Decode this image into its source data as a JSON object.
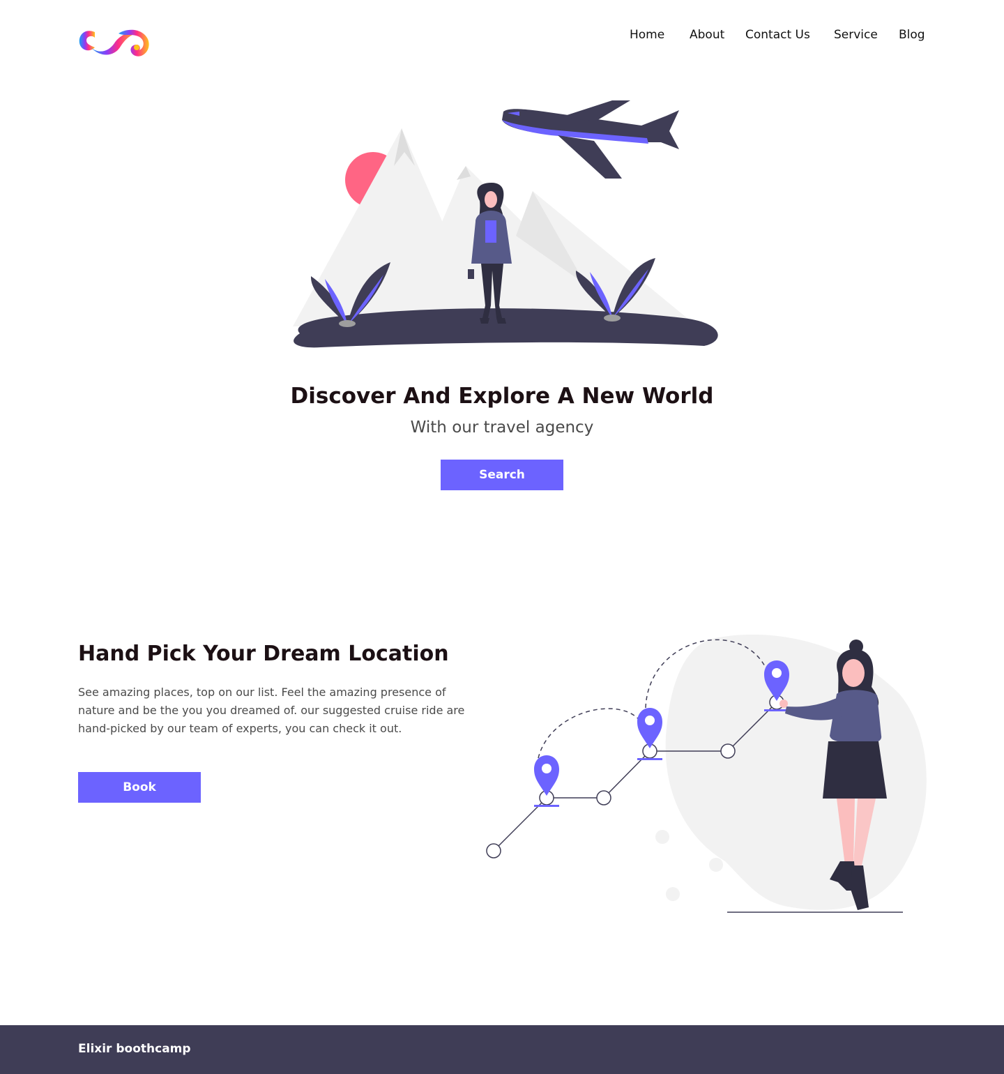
{
  "nav": {
    "items": [
      {
        "label": "Home"
      },
      {
        "label": "About"
      },
      {
        "label": "Contact Us"
      },
      {
        "label": "Service"
      },
      {
        "label": "Blog"
      }
    ]
  },
  "hero": {
    "title": "Discover And Explore A New World",
    "subtitle": "With our travel agency",
    "search_label": "Search"
  },
  "feature": {
    "title": "Hand Pick Your Dream Location",
    "paragraph": "See amazing places, top on our list. Feel the amazing presence of nature and be the you you dreamed of. our suggested cruise ride are  hand-picked by our team of experts, you can check it out.",
    "book_label": "Book"
  },
  "footer": {
    "text": "Elixir boothcamp"
  },
  "icons": {
    "logo": "infinity-swirl-logo",
    "hero": "traveler-mountains-plane-illustration",
    "feature": "woman-location-pins-illustration"
  },
  "colors": {
    "accent": "#6c63ff",
    "dark": "#3f3d56",
    "sun": "#ff6584",
    "mountain": "#f2f2f2",
    "text": "#1c1014"
  }
}
